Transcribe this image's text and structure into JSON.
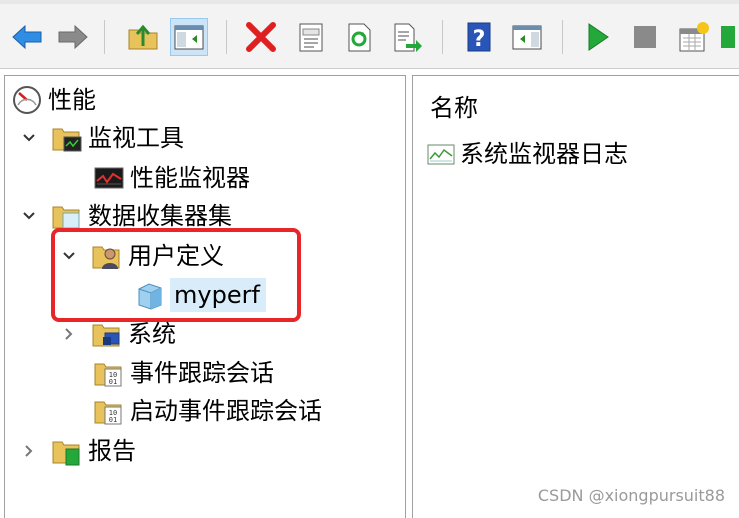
{
  "toolbar": {
    "buttons": [
      {
        "name": "back-arrow-icon"
      },
      {
        "name": "forward-arrow-icon"
      },
      {
        "name": "up-folder-icon"
      },
      {
        "name": "show-hide-tree-icon"
      },
      {
        "name": "delete-icon"
      },
      {
        "name": "properties-icon"
      },
      {
        "name": "refresh-icon"
      },
      {
        "name": "export-list-icon"
      },
      {
        "name": "help-icon"
      },
      {
        "name": "show-hide-action-pane-icon"
      },
      {
        "name": "start-icon"
      },
      {
        "name": "stop-icon"
      },
      {
        "name": "new-data-collector-icon"
      }
    ]
  },
  "tree": {
    "root_label": "性能",
    "monitoring_tools_label": "监视工具",
    "perf_monitor_label": "性能监视器",
    "data_collector_sets_label": "数据收集器集",
    "user_defined_label": "用户定义",
    "myperf_label": "myperf",
    "system_label": "系统",
    "event_trace_label": "事件跟踪会话",
    "startup_event_trace_label": "启动事件跟踪会话",
    "reports_label": "报告"
  },
  "list": {
    "column_name": "名称",
    "items": [
      {
        "label": "系统监视器日志"
      }
    ]
  },
  "watermark": "CSDN @xiongpursuit88",
  "colors": {
    "highlight_border": "#e8262a",
    "selection_bg": "#d9ecfa",
    "arrow_blue": "#2f8de4",
    "delete_red": "#e02020",
    "start_green": "#25a83a"
  }
}
